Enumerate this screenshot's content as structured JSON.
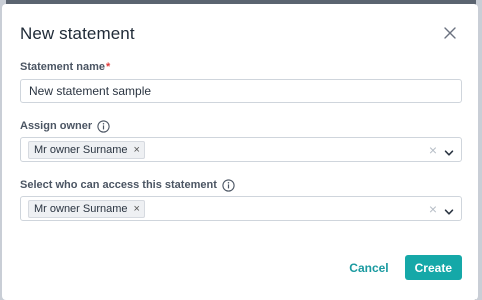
{
  "dialog": {
    "title": "New statement",
    "close_icon": "close-icon"
  },
  "statement_name": {
    "label": "Statement name",
    "required_mark": "*",
    "value": "New statement sample"
  },
  "assign_owner": {
    "label": "Assign owner",
    "info_icon": "info-icon",
    "chips": [
      "Mr owner Surname"
    ],
    "chip_remove": "×",
    "clear": "×"
  },
  "access": {
    "label": "Select who can access this statement",
    "info_icon": "info-icon",
    "chips": [
      "Mr owner Surname"
    ],
    "chip_remove": "×",
    "clear": "×"
  },
  "actions": {
    "cancel_label": "Cancel",
    "create_label": "Create"
  },
  "colors": {
    "accent": "#15a8a8",
    "required": "#e03b3b",
    "title": "#1f2a37"
  }
}
